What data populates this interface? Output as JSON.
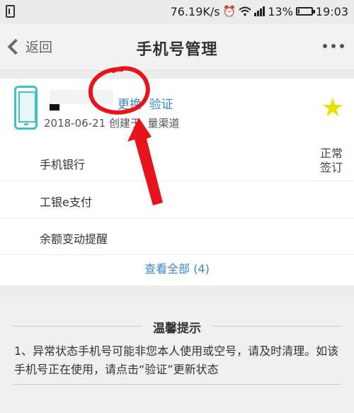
{
  "status_bar": {
    "speed": "76.19K/s",
    "battery": "13%",
    "battery_level": 0.13,
    "time": "19:03",
    "icons": [
      "sim-icon",
      "alarm-icon",
      "wifi-icon",
      "signal-icon",
      "battery-icon"
    ]
  },
  "nav": {
    "back_label": "返回",
    "title": "手机号管理",
    "more_icon": "more-dots-icon"
  },
  "card": {
    "action_label": "更换  验证",
    "created_label": "2018-06-21 创建于  量渠道",
    "status": "正常签订",
    "services": [
      "手机银行",
      "工银e支付",
      "余额变动提醒"
    ],
    "view_all": "查看全部 (4)"
  },
  "tips": {
    "title": "温馨提示",
    "text": "1、异常状态手机号可能非您本人使用或空号，请及时清理。如该手机号正在使用，请点击“验证”更新状态"
  },
  "colors": {
    "link": "#3a86c8",
    "phone_icon": "#3cc4c4",
    "star": "#e8e000",
    "annotation": "#e8141c"
  }
}
